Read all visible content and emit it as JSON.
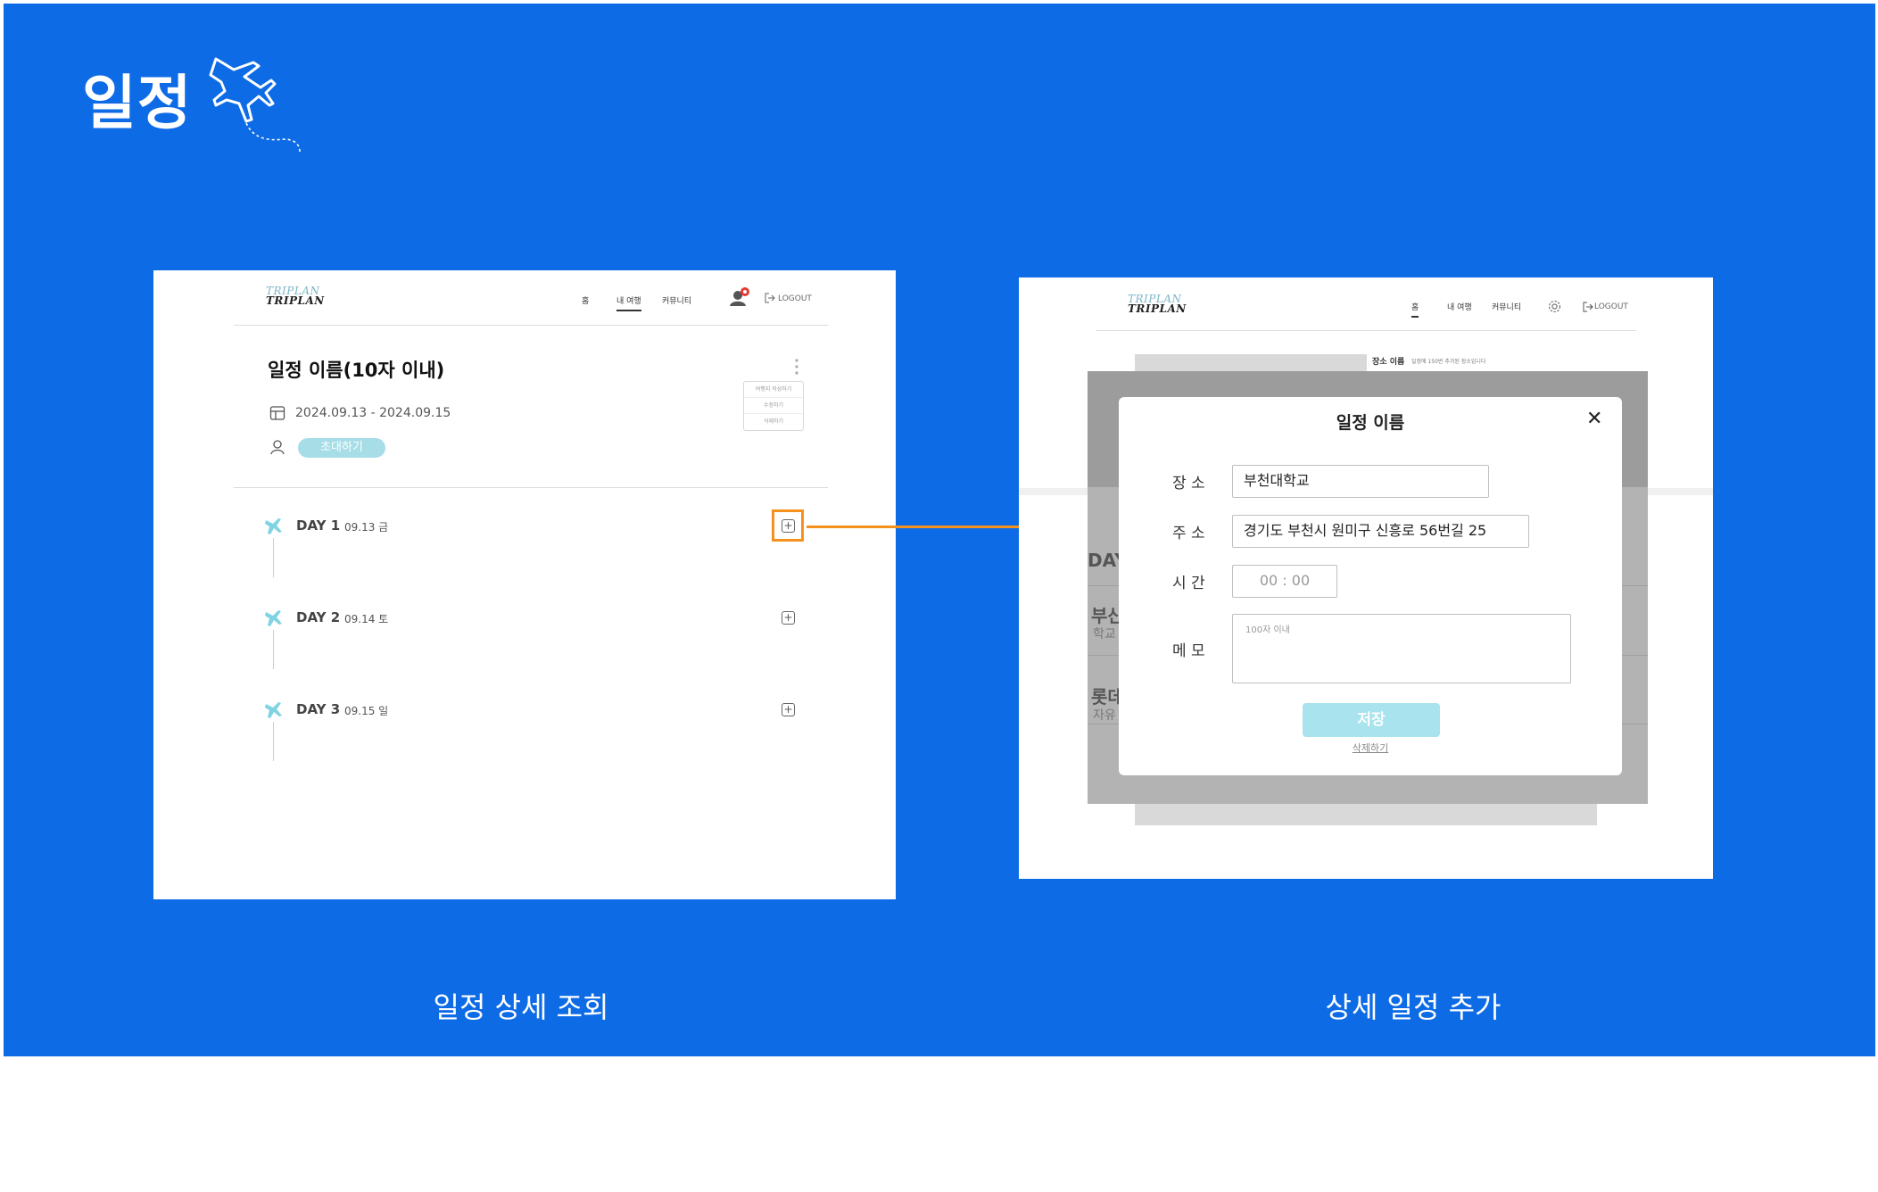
{
  "header": {
    "title": "일정"
  },
  "colors": {
    "background": "#0d6be6",
    "accent_highlight": "#f5921e",
    "mint": "#a6dde7"
  },
  "left_screen": {
    "logo": "TRIPLAN",
    "nav": [
      "홈",
      "내 여행",
      "커뮤니티"
    ],
    "logout": "LOGOUT",
    "trip_title": "일정 이름(10자 이내)",
    "dates": "2024.09.13 - 2024.09.15",
    "invite_label": "초대하기",
    "menu_items": [
      "여행지 작성하기",
      "수정하기",
      "삭제하기"
    ],
    "days": [
      {
        "label": "DAY 1",
        "date": "09.13 금"
      },
      {
        "label": "DAY 2",
        "date": "09.14 토"
      },
      {
        "label": "DAY 3",
        "date": "09.15 일"
      }
    ]
  },
  "right_screen": {
    "logo": "TRIPLAN",
    "nav": [
      "홈",
      "내 여행",
      "커뮤니티"
    ],
    "logout": "LOGOUT",
    "place_header": "장소 이름",
    "place_header_sub": "일정에 150번 추가된 장소입니다",
    "behind": {
      "day": "DAY",
      "item1_title": "부산",
      "item1_sub": "학교",
      "item2_title": "롯데",
      "item2_sub": "자유"
    },
    "modal": {
      "title": "일정 이름",
      "place_label": "장 소",
      "place_value": "부천대학교",
      "address_label": "주 소",
      "address_value": "경기도 부천시 원미구 신흥로 56번길 25",
      "time_label": "시 간",
      "time_value": "00 : 00",
      "memo_label": "메 모",
      "memo_placeholder": "100자 이내",
      "save_label": "저장",
      "delete_label": "삭제하기"
    }
  },
  "captions": {
    "left": "일정 상세 조회",
    "right": "상세 일정 추가"
  }
}
